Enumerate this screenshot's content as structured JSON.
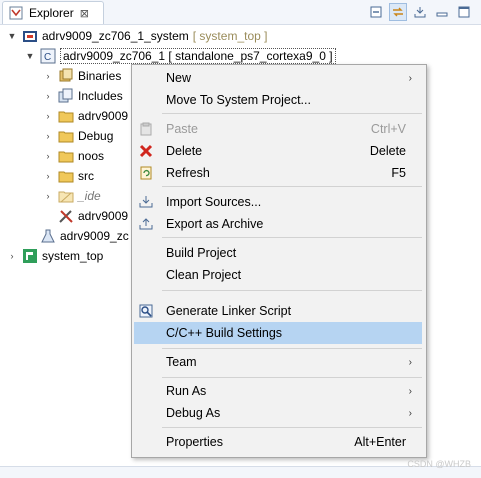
{
  "view": {
    "tab_label": "Explorer",
    "close_glyph": "⊠"
  },
  "tree": {
    "system": {
      "name": "adrv9009_zc706_1_system",
      "tag": "[ system_top ]"
    },
    "app": {
      "name": "adrv9009_zc706_1 [ standalone_ps7_cortexa9_0 ]"
    },
    "children": [
      {
        "label": "Binaries"
      },
      {
        "label": "Includes"
      },
      {
        "label": "adrv9009"
      },
      {
        "label": "Debug"
      },
      {
        "label": "noos"
      },
      {
        "label": "src"
      },
      {
        "label": "_ide"
      },
      {
        "label": "adrv9009"
      }
    ],
    "system_partial": {
      "label": "adrv9009_zc"
    },
    "platform": {
      "name": "system_top"
    }
  },
  "menu": {
    "new": "New",
    "move_to_system": "Move To System Project...",
    "paste": "Paste",
    "paste_shortcut": "Ctrl+V",
    "delete": "Delete",
    "delete_shortcut": "Delete",
    "refresh": "Refresh",
    "refresh_shortcut": "F5",
    "import_sources": "Import Sources...",
    "export_archive": "Export as Archive",
    "build_project": "Build Project",
    "clean_project": "Clean Project",
    "generate_linker": "Generate Linker Script",
    "build_settings": "C/C++ Build Settings",
    "team": "Team",
    "run_as": "Run As",
    "debug_as": "Debug As",
    "properties": "Properties",
    "properties_shortcut": "Alt+Enter"
  },
  "watermark": "CSDN @WHZB",
  "colors": {
    "highlight": "#b6d4f2",
    "tag": "#9a8c5a",
    "menu_bg": "#f2f2f2"
  }
}
